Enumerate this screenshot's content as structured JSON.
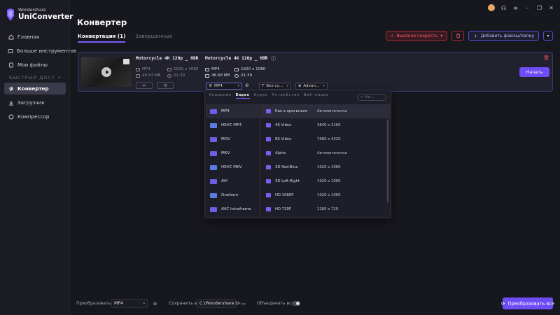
{
  "app": {
    "brand_small": "Wondershare",
    "brand_name": "UniConverter"
  },
  "sidebar": {
    "items": [
      {
        "label": "Главная",
        "icon": "home-icon"
      },
      {
        "label": "Больше инструментов",
        "icon": "tools-icon"
      },
      {
        "label": "Мои файлы",
        "icon": "files-icon"
      }
    ],
    "section_label": "БЫСТРЫЙ ДОСТ",
    "items2": [
      {
        "label": "Конвертер",
        "icon": "converter-icon",
        "active": true
      },
      {
        "label": "Загрузчик",
        "icon": "download-icon"
      },
      {
        "label": "Компрессор",
        "icon": "compress-icon"
      }
    ]
  },
  "header": {
    "title": "Конвертер"
  },
  "tabs": [
    {
      "label": "Конвертация (1)",
      "active": true
    },
    {
      "label": "Завершенные",
      "active": false
    }
  ],
  "toolbar": {
    "speed_label": "Высокая скорость",
    "add_files_label": "Добавить файлы/папку"
  },
  "file": {
    "src_name": "Motorcycle 4K 120p _ HDR",
    "dst_name": "Motorcycle 4K 120p _ HDR",
    "src_format": "MP4",
    "src_resolution": "1920 x 1080",
    "src_size": "46.83 MB",
    "src_duration": "01:39",
    "dst_format": "MP4",
    "dst_resolution": "1920 x 1080",
    "dst_size": "46.68 MB",
    "dst_duration": "01:39",
    "format_select": "MP4",
    "subtitle_select": "Без су...",
    "audio_select": "Advan...",
    "start_label": "Начать"
  },
  "format_panel": {
    "tabs": [
      {
        "label": "Недавние",
        "active": false
      },
      {
        "label": "Видео",
        "active": true
      },
      {
        "label": "Аудио",
        "active": false
      },
      {
        "label": "Устройство",
        "active": false
      },
      {
        "label": "Веб-видео",
        "active": false
      }
    ],
    "search_placeholder": "На...",
    "formats": [
      {
        "label": "MP4",
        "active": true
      },
      {
        "label": "HEVC MP4"
      },
      {
        "label": "MOV"
      },
      {
        "label": "MKV"
      },
      {
        "label": "HEVC MKV"
      },
      {
        "label": "AVI"
      },
      {
        "label": "Oneform"
      },
      {
        "label": "AVC Intraframe"
      }
    ],
    "presets": [
      {
        "name": "Как в оригинале",
        "res": "Автоматически",
        "active": true
      },
      {
        "name": "4K Video",
        "res": "3840 x 2160"
      },
      {
        "name": "8K Video",
        "res": "7680 x 4320"
      },
      {
        "name": "Alpha",
        "res": "Автоматически"
      },
      {
        "name": "3D Red-Blue",
        "res": "1920 x 1080"
      },
      {
        "name": "3D Left-Right",
        "res": "1920 x 1080"
      },
      {
        "name": "HD 1080P",
        "res": "1920 x 1080"
      },
      {
        "name": "HD 720P",
        "res": "1280 x 720"
      }
    ]
  },
  "bottom": {
    "convert_to_label": "Преобразовать в",
    "convert_to_value": "MP4",
    "save_to_label": "Сохранить в",
    "save_to_value": "C:\\Wondershare U",
    "merge_label": "Объединить вс...",
    "convert_all_label": "Преобразовать все"
  },
  "colors": {
    "accent": "#6e4cf6",
    "danger": "#ff5b6e",
    "background": "#17171e"
  }
}
